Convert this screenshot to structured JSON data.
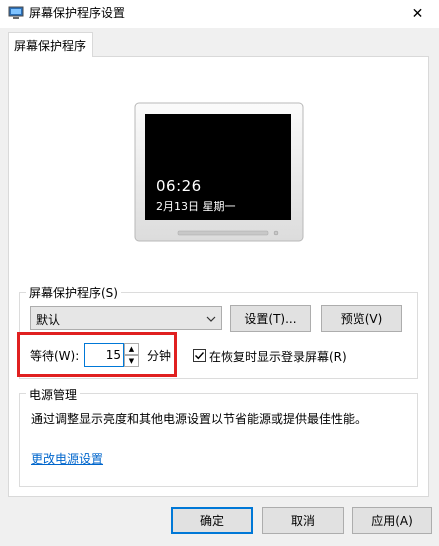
{
  "window": {
    "title": "屏幕保护程序设置",
    "close_glyph": "✕"
  },
  "tabs": [
    {
      "label": "屏幕保护程序"
    }
  ],
  "preview": {
    "time": "06:26",
    "date": "2月13日  星期一"
  },
  "screensaver": {
    "group_label": "屏幕保护程序(S)",
    "selected": "默认",
    "settings_label": "设置(T)...",
    "preview_label": "预览(V)",
    "wait_label": "等待(W):",
    "wait_value": "15",
    "minutes_label": "分钟",
    "resume_label": "在恢复时显示登录屏幕(R)",
    "resume_checked": true
  },
  "power": {
    "group_label": "电源管理",
    "description": "通过调整显示亮度和其他电源设置以节省能源或提供最佳性能。",
    "link": "更改电源设置"
  },
  "buttons": {
    "ok": "确定",
    "cancel": "取消",
    "apply": "应用(A)"
  },
  "colors": {
    "accent": "#0078d7",
    "highlight": "#e02020",
    "link": "#0066cc"
  }
}
